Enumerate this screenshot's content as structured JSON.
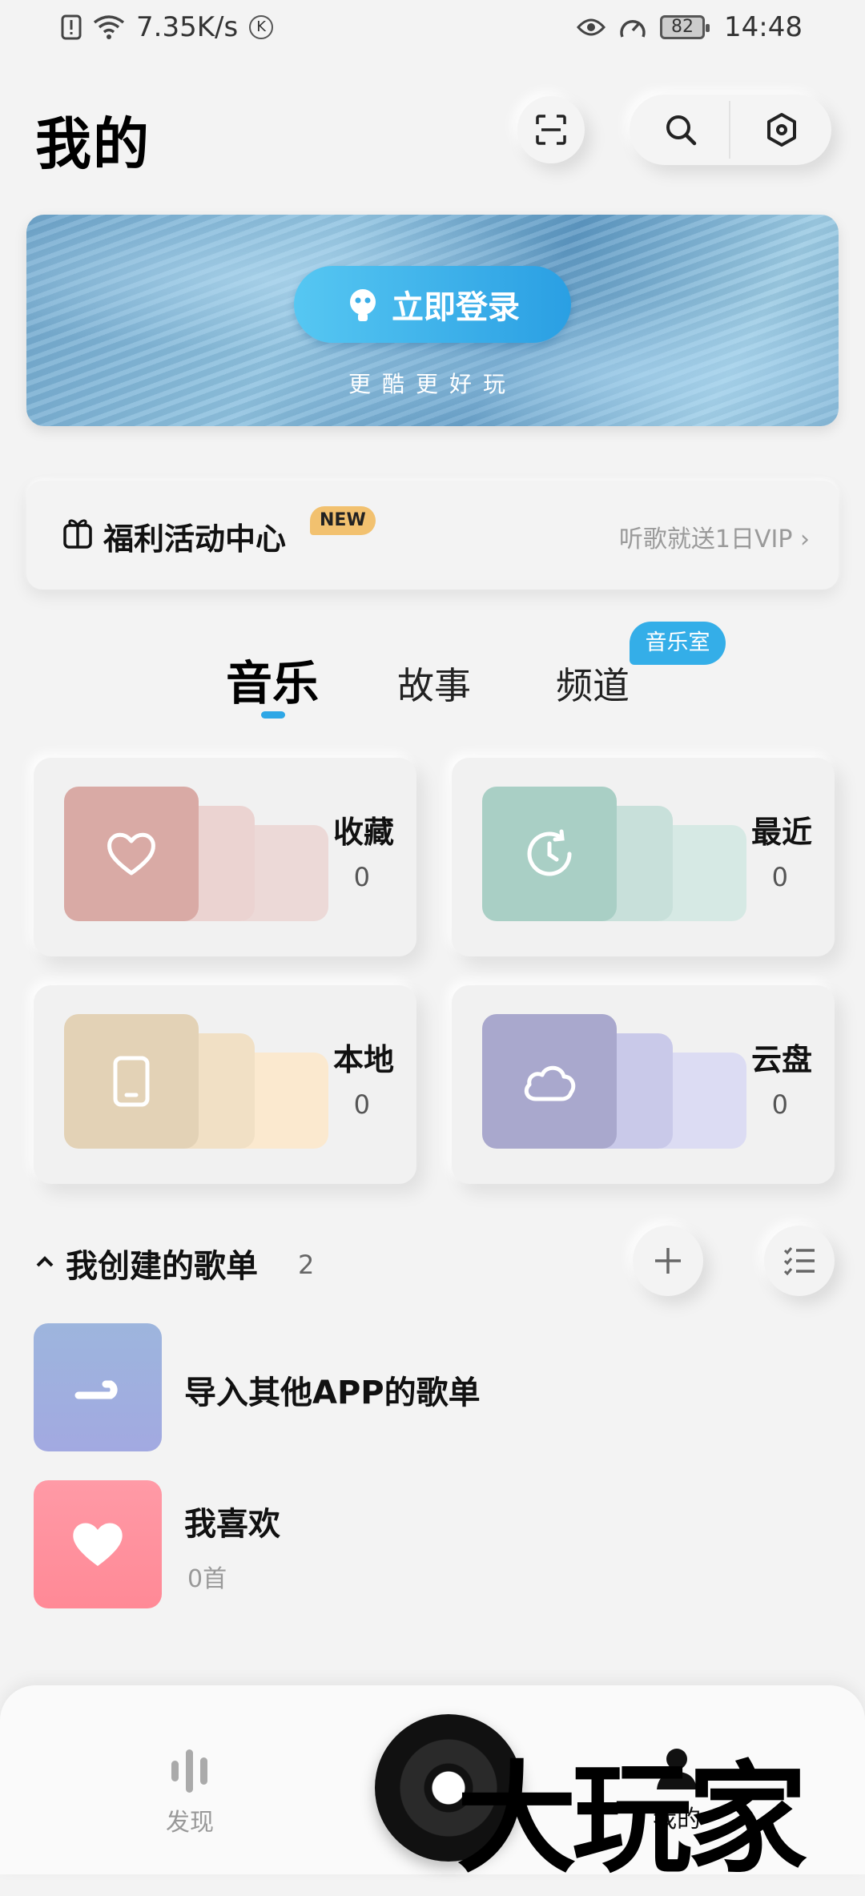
{
  "status_bar": {
    "speed": "7.35K/s",
    "k_badge": "K",
    "battery": "82",
    "time": "14:48"
  },
  "header": {
    "title": "我的"
  },
  "banner": {
    "login_label": "立即登录",
    "subtitle": "更酷更好玩"
  },
  "welfare": {
    "label": "福利活动中心",
    "new_badge": "NEW",
    "right_text": "听歌就送1日VIP"
  },
  "tabs": [
    {
      "label": "音乐",
      "active": true
    },
    {
      "label": "故事",
      "active": false
    },
    {
      "label": "频道",
      "active": false,
      "badge": "音乐室"
    }
  ],
  "cards": [
    {
      "name": "收藏",
      "count": "0",
      "icon": "heart-icon",
      "color": "#d9aaa5"
    },
    {
      "name": "最近",
      "count": "0",
      "icon": "clock-icon",
      "color": "#a9cfc5"
    },
    {
      "name": "本地",
      "count": "0",
      "icon": "phone-icon",
      "color": "#e3d2b6"
    },
    {
      "name": "云盘",
      "count": "0",
      "icon": "cloud-icon",
      "color": "#a9a8cd"
    }
  ],
  "playlists_section": {
    "title": "我创建的歌单",
    "count": "2",
    "items": [
      {
        "title": "导入其他APP的歌单",
        "sub": ""
      },
      {
        "title": "我喜欢",
        "sub": "0首"
      }
    ]
  },
  "bottom_nav": {
    "items": [
      {
        "label": "发现"
      },
      {
        "label": "我的"
      }
    ],
    "watermark": "大玩家"
  }
}
